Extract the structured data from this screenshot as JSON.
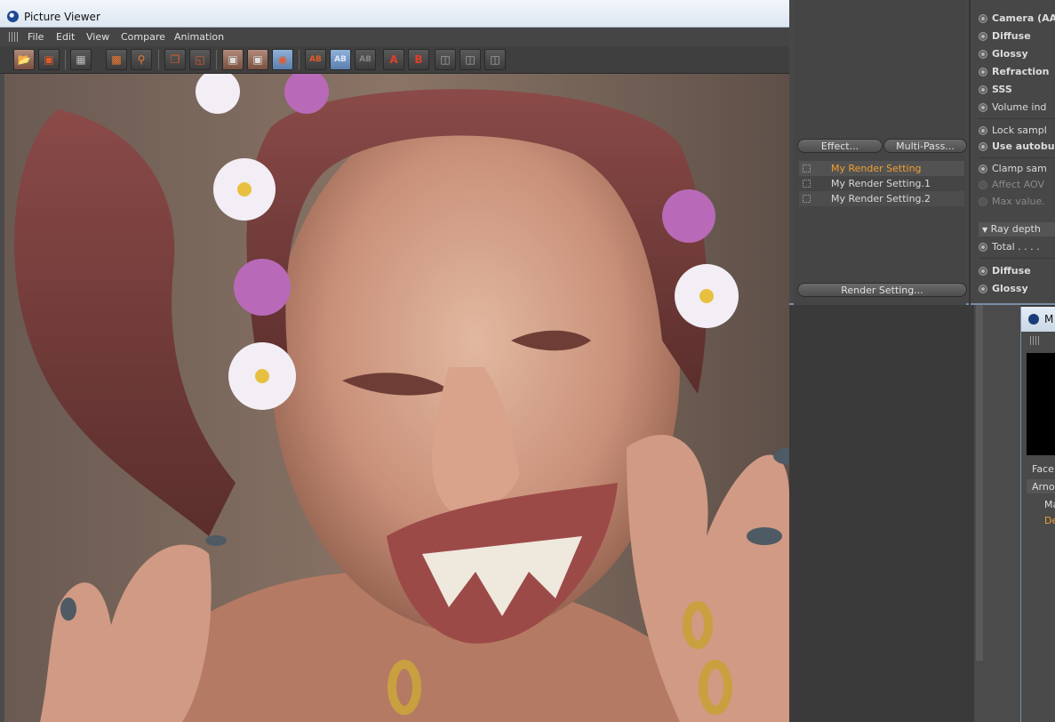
{
  "picture_viewer": {
    "title": "Picture Viewer",
    "menu": [
      "File",
      "Edit",
      "View",
      "Compare",
      "Animation"
    ],
    "toolbar_icons": [
      "open-file-icon",
      "save-file-icon",
      "grid-icon",
      "channels-icon",
      "zoom-icon",
      "copy-icon",
      "compare-icon",
      "display-icon",
      "display-alt-icon",
      "filter-icon",
      "ab-icon",
      "ab-split-icon",
      "ab-swap-icon",
      "set-a-icon",
      "set-b-icon",
      "layout-1-icon",
      "layout-2-icon",
      "layout-3-icon"
    ],
    "toolbar_text": {
      "ab": "AB",
      "set_a": "A",
      "set_b": "B"
    }
  },
  "render_settings": {
    "effect_button": "Effect...",
    "multipass_button": "Multi-Pass...",
    "render_setting_button": "Render Setting...",
    "items": [
      {
        "label": "My Render Setting",
        "active": true
      },
      {
        "label": "My Render Setting.1",
        "active": false
      },
      {
        "label": "My Render Setting.2",
        "active": false
      }
    ],
    "props": {
      "camera": "Camera (AA",
      "diffuse": "Diffuse",
      "glossy": "Glossy",
      "refraction": "Refraction",
      "sss": "SSS",
      "volume": "Volume ind",
      "lock": "Lock sampl",
      "autobump": "Use autobu",
      "clamp": "Clamp sam",
      "affect_aov": "Affect AOV",
      "max_value": "Max value.",
      "ray_depth": "Ray depth",
      "total": "Total . . . .",
      "diffuse2": "Diffuse",
      "glossy2": "Glossy"
    }
  },
  "material_manager": {
    "title": "M",
    "face_label": "Face",
    "arnold_label": "Arno",
    "ma_label": "Ma",
    "de_label": "De"
  },
  "colors": {
    "accent_orange": "#f0a030",
    "panel_gray": "#474747",
    "title_bar": "#e8eef6"
  }
}
